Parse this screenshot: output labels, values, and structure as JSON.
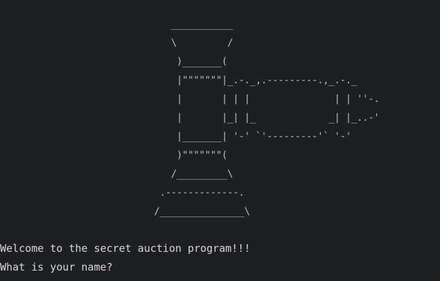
{
  "terminal": {
    "background": "#1e1f22",
    "foreground": "#d4d4d4",
    "logo_art": "      ___________\n      \\         /\n       )_______(\n       |\"\"\"\"\"\"\"|_.-._,.---------.,_.-._\n       |       | | |               | | ''-.\n       |       |_| |_             _| |_..-'\n       |_______| '-' `'---------'` '-'\n       )\"\"\"\"\"\"\"(\n      /_________\\\n    .-------------.\n   /_______________\\",
    "lines": [
      "Welcome to the secret auction program!!!",
      "What is your name?"
    ]
  }
}
